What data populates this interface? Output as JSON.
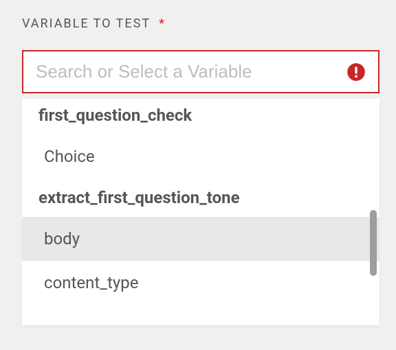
{
  "field": {
    "label": "VARIABLE TO TEST",
    "required_mark": "*"
  },
  "search": {
    "placeholder": "Search or Select a Variable",
    "value": ""
  },
  "dropdown": {
    "groups": [
      {
        "name": "first_question_check",
        "options": [
          {
            "label": "Choice",
            "highlighted": false
          }
        ]
      },
      {
        "name": "extract_first_question_tone",
        "options": [
          {
            "label": "body",
            "highlighted": true
          },
          {
            "label": "content_type",
            "highlighted": false
          }
        ]
      }
    ]
  }
}
